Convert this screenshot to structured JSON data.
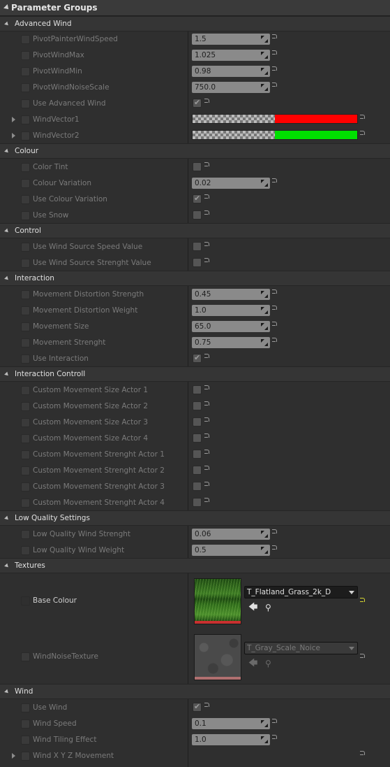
{
  "panel": {
    "title": "Parameter Groups"
  },
  "colors": {
    "vector1": "#ff0000",
    "vector2": "#00e000",
    "texture_bar_active": "#c83030",
    "texture_bar_inactive": "#b07070"
  },
  "icons": {
    "reset": "reset-arrow-icon",
    "expand": "triangle-right-icon",
    "browse": "use-selected-arrow-icon",
    "find": "magnifier-icon"
  },
  "advanced_wind": {
    "label": "Advanced Wind",
    "params": [
      {
        "label": "PivotPainterWindSpeed",
        "value": "1.5"
      },
      {
        "label": "PivotWindMax",
        "value": "1.025"
      },
      {
        "label": "PivotWindMin",
        "value": "0.98"
      },
      {
        "label": "PivotWindNoiseScale",
        "value": "750.0"
      },
      {
        "label": "Use Advanced Wind",
        "checked": true
      },
      {
        "label": "WindVector1",
        "color": "red"
      },
      {
        "label": "WindVector2",
        "color": "green"
      }
    ]
  },
  "colour": {
    "label": "Colour",
    "params": [
      {
        "label": "Color Tint",
        "checked": false
      },
      {
        "label": "Colour Variation",
        "value": "0.02"
      },
      {
        "label": "Use Colour Variation",
        "checked": true
      },
      {
        "label": "Use Snow",
        "checked": false
      }
    ]
  },
  "control": {
    "label": "Control",
    "params": [
      {
        "label": "Use Wind Source Speed Value",
        "checked": false
      },
      {
        "label": "Use Wind Source Strenght Value",
        "checked": false
      }
    ]
  },
  "interaction": {
    "label": "Interaction",
    "params": [
      {
        "label": "Movement Distortion Strength",
        "value": "0.45"
      },
      {
        "label": "Movement Distortion Weight",
        "value": "1.0"
      },
      {
        "label": "Movement Size",
        "value": "65.0"
      },
      {
        "label": "Movement Strenght",
        "value": "0.75"
      },
      {
        "label": "Use Interaction",
        "checked": true
      }
    ]
  },
  "interaction_controll": {
    "label": "Interaction Controll",
    "params": [
      {
        "label": "Custom Movement Size Actor 1"
      },
      {
        "label": "Custom Movement Size Actor 2"
      },
      {
        "label": "Custom Movement Size Actor 3"
      },
      {
        "label": "Custom Movement Size Actor 4"
      },
      {
        "label": "Custom Movement Strenght Actor 1"
      },
      {
        "label": "Custom Movement Strenght Actor 2"
      },
      {
        "label": "Custom Movement Strenght Actor 3"
      },
      {
        "label": "Custom Movement Strenght Actor 4"
      }
    ]
  },
  "low_quality": {
    "label": "Low Quality Settings",
    "params": [
      {
        "label": "Low Quality Wind Strenght",
        "value": "0.06"
      },
      {
        "label": "Low Quality Wind Weight",
        "value": "0.5"
      }
    ]
  },
  "textures": {
    "label": "Textures",
    "params": [
      {
        "label": "Base Colour",
        "asset": "T_Flatland_Grass_2k_D",
        "enabled": true
      },
      {
        "label": "WindNoiseTexture",
        "asset": "T_Gray_Scale_Noice",
        "enabled": false
      }
    ]
  },
  "wind": {
    "label": "Wind",
    "params": [
      {
        "label": "Use Wind",
        "checked": true
      },
      {
        "label": "Wind Speed",
        "value": "0.1"
      },
      {
        "label": "Wind Tiling Effect",
        "value": "1.0"
      },
      {
        "label": "Wind X Y Z Movement"
      }
    ]
  }
}
